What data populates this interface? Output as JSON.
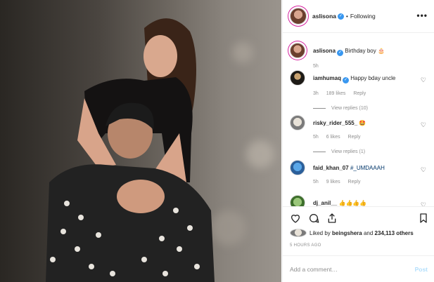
{
  "post": {
    "username": "aslisona",
    "following_label": "Following",
    "more_label": "•••",
    "caption": "Birthday boy 🎂",
    "caption_time": "5h"
  },
  "comments": [
    {
      "username": "iamhumaq",
      "text": "Happy bday uncle",
      "time": "3h",
      "likes": "189 likes",
      "reply": "Reply",
      "view_replies": "View replies (10)"
    },
    {
      "username": "risky_rider_555_",
      "text": "🤩",
      "time": "5h",
      "likes": "6 likes",
      "reply": "Reply",
      "view_replies": "View replies (1)"
    },
    {
      "username": "faid_khan_07",
      "text": "#_UMDAAAH",
      "time": "5h",
      "likes": "9 likes",
      "reply": "Reply"
    },
    {
      "username": "dj_anil__",
      "text": "👍👍👍👍"
    }
  ],
  "likes": {
    "prefix": "Liked by",
    "user": "beingshera",
    "joiner": "and",
    "others": "234,113 others"
  },
  "timestamp": "5 HOURS AGO",
  "add_comment": {
    "placeholder": "Add a comment…",
    "post_label": "Post"
  },
  "icons": [
    "heart-icon",
    "comment-icon",
    "share-icon",
    "bookmark-icon",
    "more-icon"
  ],
  "colors": {
    "verified": "#3897f0",
    "post_disabled": "#b2dffc",
    "hashtag": "#003569",
    "meta_gray": "#8e8e8e"
  }
}
